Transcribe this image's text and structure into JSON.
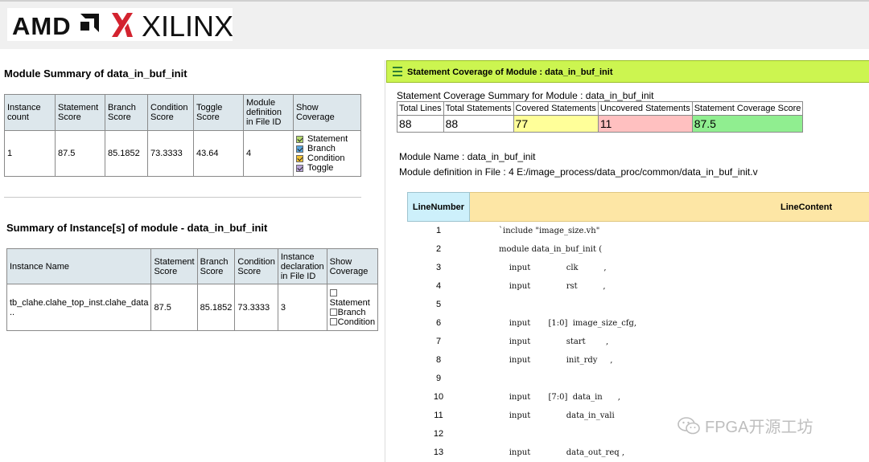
{
  "brand": {
    "amd": "AMD",
    "xilinx": "XILINX"
  },
  "module_summary": {
    "title": "Module Summary of data_in_buf_init",
    "headers": [
      "Instance count",
      "Statement Score",
      "Branch Score",
      "Condition Score",
      "Toggle Score",
      "Module definition in File ID",
      "Show Coverage"
    ],
    "row": [
      "1",
      "87.5",
      "85.1852",
      "73.3333",
      "43.64",
      "4"
    ],
    "coverage": [
      {
        "label": "Statement",
        "color": "#b5d96e"
      },
      {
        "label": "Branch",
        "color": "#56a6e0"
      },
      {
        "label": "Condition",
        "color": "#f1c232"
      },
      {
        "label": "Toggle",
        "color": "#b9a4d8"
      }
    ]
  },
  "instance_summary": {
    "title": "Summary of Instance[s] of module - data_in_buf_init",
    "headers": [
      "Instance Name",
      "Statement Score",
      "Branch Score",
      "Condition Score",
      "Instance declaration in File ID",
      "Show Coverage"
    ],
    "row": [
      "tb_clahe.clahe_top_inst.clahe_data ..",
      "87.5",
      "85.1852",
      "73.3333",
      "3"
    ],
    "coverage": [
      "Statement",
      "Branch",
      "Condition"
    ]
  },
  "statement_panel": {
    "title": "Statement Coverage of Module : data_in_buf_init",
    "summary_caption": "Statement Coverage Summary for Module : data_in_buf_init",
    "headers": [
      "Total Lines",
      "Total Statements",
      "Covered Statements",
      "Uncovered Statements",
      "Statement Coverage Score"
    ],
    "values": [
      "88",
      "88",
      "77",
      "11",
      "87.5"
    ],
    "colors": {
      "covered": "#ffff99",
      "uncovered": "#ffc0c0",
      "score": "#90ee90"
    },
    "module_name": "Module Name : data_in_buf_init",
    "module_def": "Module definition in File : 4 E:/image_process/data_proc/common/data_in_buf_init.v",
    "col_line_number": "LineNumber",
    "col_line_content": "LineContent",
    "lines": [
      {
        "n": "1",
        "code": "`include \"image_size.vh\""
      },
      {
        "n": "2",
        "code": "module data_in_buf_init ("
      },
      {
        "n": "3",
        "code": "    input              clk          ,"
      },
      {
        "n": "4",
        "code": "    input              rst          ,"
      },
      {
        "n": "5",
        "code": ""
      },
      {
        "n": "6",
        "code": "    input       [1:0]  image_size_cfg,"
      },
      {
        "n": "7",
        "code": "    input              start        ,"
      },
      {
        "n": "8",
        "code": "    input              init_rdy     ,"
      },
      {
        "n": "9",
        "code": ""
      },
      {
        "n": "10",
        "code": "    input       [7:0]  data_in      ,"
      },
      {
        "n": "11",
        "code": "    input              data_in_vali"
      },
      {
        "n": "12",
        "code": ""
      },
      {
        "n": "13",
        "code": "    input              data_out_req ,"
      }
    ]
  },
  "watermark": "FPGA开源工坊"
}
